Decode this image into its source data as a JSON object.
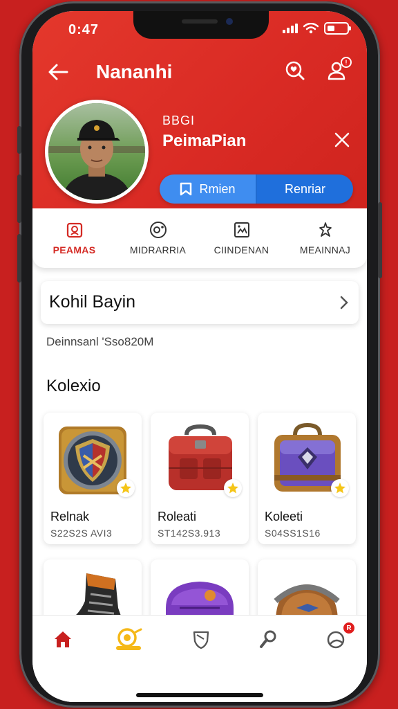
{
  "status": {
    "time": "0:47"
  },
  "header": {
    "title": "Nananhi",
    "back_icon": "arrow-left-icon",
    "search_icon": "search-heart-icon",
    "profile_icon": "user-icon",
    "notification_badge": "!"
  },
  "profile": {
    "subtitle": "BBGI",
    "name": "PeimaPian",
    "close_icon": "close-icon"
  },
  "actions": {
    "primary_label": "Rmien",
    "secondary_label": "Renriar"
  },
  "tabs": [
    {
      "label": "PEAMAS",
      "icon": "badge-icon",
      "active": true
    },
    {
      "label": "MIDRARRIA",
      "icon": "camera-icon",
      "active": false
    },
    {
      "label": "CIINDENAN",
      "icon": "image-icon",
      "active": false
    },
    {
      "label": "MEAINNAJ",
      "icon": "hand-icon",
      "active": false
    }
  ],
  "user_card": {
    "name": "Kohil Bayin"
  },
  "meta": {
    "text": "Deinnsanl 'Sso820M"
  },
  "section": {
    "title": "Kolexio"
  },
  "collection": [
    {
      "name": "Relnak",
      "value": "S22S2S AVI3",
      "art": "shield-medal"
    },
    {
      "name": "Roleati",
      "value": "ST142S3.913",
      "art": "red-bag"
    },
    {
      "name": "Koleeti",
      "value": "S04SS1S16",
      "art": "purple-chest"
    },
    {
      "name": "",
      "value": "",
      "art": "boot"
    },
    {
      "name": "",
      "value": "",
      "art": "purple-backpack"
    },
    {
      "name": "",
      "value": "",
      "art": "bronze-helmet"
    }
  ],
  "bottom_nav": {
    "items": [
      "home-icon",
      "rewards-icon",
      "shield-icon",
      "search-user-icon",
      "profile-icon"
    ],
    "badge": "R"
  },
  "colors": {
    "accent": "#d92a24",
    "blue": "#1f6fdc",
    "star": "#f5c518"
  }
}
